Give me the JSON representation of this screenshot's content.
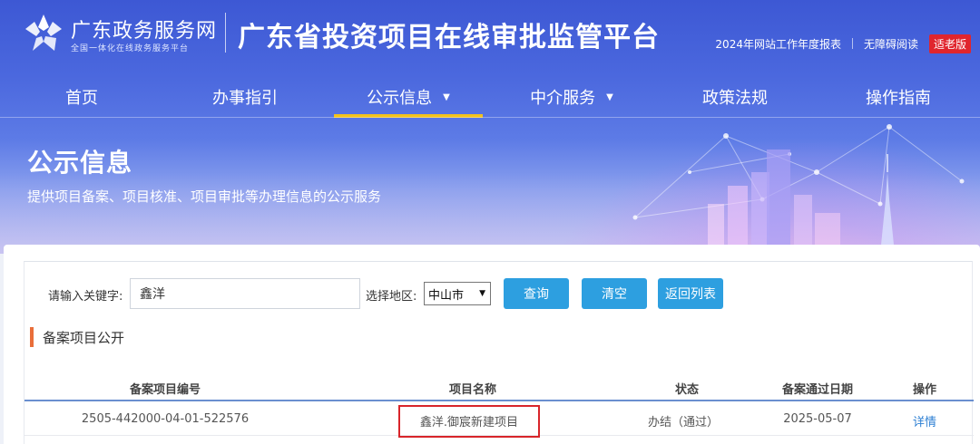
{
  "header": {
    "portal_name": "广东政务服务网",
    "portal_sub": "全国一体化在线政务服务平台",
    "platform_title": "广东省投资项目在线审批监管平台",
    "links": [
      "2024年网站工作年度报表",
      "无障碍阅读"
    ],
    "elder_mode": "适老版"
  },
  "nav": {
    "items": [
      {
        "label": "首页",
        "has_dropdown": false,
        "active": false
      },
      {
        "label": "办事指引",
        "has_dropdown": false,
        "active": false
      },
      {
        "label": "公示信息",
        "has_dropdown": true,
        "active": true
      },
      {
        "label": "中介服务",
        "has_dropdown": true,
        "active": false
      },
      {
        "label": "政策法规",
        "has_dropdown": false,
        "active": false
      },
      {
        "label": "操作指南",
        "has_dropdown": false,
        "active": false
      }
    ],
    "caret": "▼"
  },
  "banner": {
    "title": "公示信息",
    "subtitle": "提供项目备案、项目核准、项目审批等办理信息的公示服务"
  },
  "search": {
    "keyword_label": "请输入关键字:",
    "keyword_value": "鑫洋",
    "region_label": "选择地区:",
    "region_value": "中山市",
    "query_button": "查询",
    "clear_button": "清空",
    "back_button": "返回列表"
  },
  "section": {
    "title": "备案项目公开"
  },
  "table": {
    "headers": [
      "备案项目编号",
      "项目名称",
      "状态",
      "备案通过日期",
      "操作"
    ],
    "rows": [
      {
        "code": "2505-442000-04-01-522576",
        "name": "鑫洋.御宸新建项目",
        "status": "办结（通过）",
        "date": "2025-05-07",
        "action": "详情"
      }
    ]
  },
  "colors": {
    "brand_blue": "#4b68de",
    "button_blue": "#2d9fe0",
    "nav_active": "#f3c21b",
    "section_accent": "#e96e3a",
    "highlight_red": "#d8252a",
    "elder_badge": "#e0252d"
  }
}
